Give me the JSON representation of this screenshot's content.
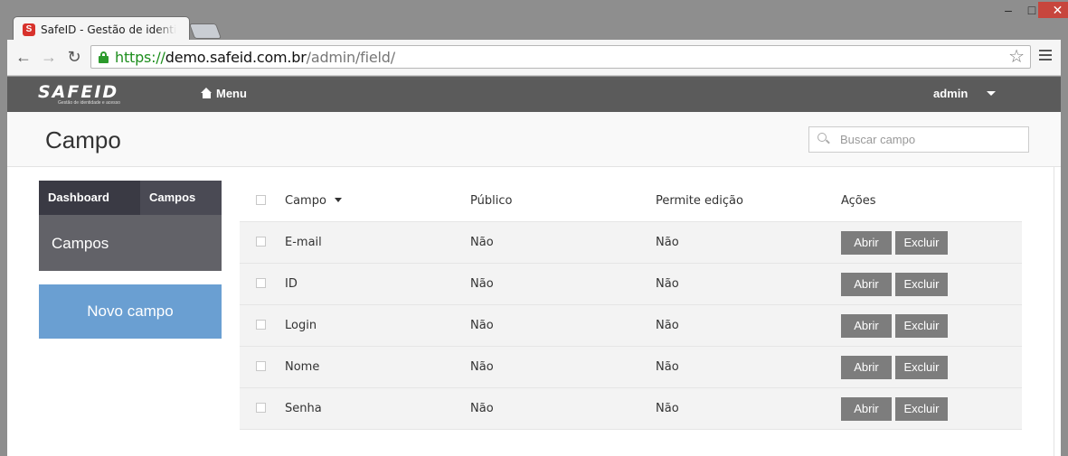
{
  "browser": {
    "tab_title": "SafeID - Gestão de identidade e acesso",
    "favicon": "S",
    "url_scheme": "https://",
    "url_host": "demo.safeid.com.br",
    "url_path": "/admin/field/",
    "window_controls": {
      "minimize": "–",
      "maximize": "□",
      "close": "✕"
    }
  },
  "topnav": {
    "logo_text": "SAFEID",
    "logo_subtitle": "Gestão de identidade e acesso",
    "menu_label": "Menu",
    "user_label": "admin",
    "bg_color": "#5b5b5b"
  },
  "header": {
    "title": "Campo",
    "search_placeholder": "Buscar campo"
  },
  "sidebar": {
    "tabs": [
      {
        "label": "Dashboard"
      },
      {
        "label": "Campos"
      }
    ],
    "active_section": "Campos",
    "new_button_label": "Novo campo",
    "accent_color": "#6a9fd2"
  },
  "table": {
    "columns": [
      "Campo",
      "Público",
      "Permite edição",
      "Ações"
    ],
    "sort_column": "Campo",
    "rows": [
      {
        "campo": "E-mail",
        "publico": "Não",
        "edicao": "Não"
      },
      {
        "campo": "ID",
        "publico": "Não",
        "edicao": "Não"
      },
      {
        "campo": "Login",
        "publico": "Não",
        "edicao": "Não"
      },
      {
        "campo": "Nome",
        "publico": "Não",
        "edicao": "Não"
      },
      {
        "campo": "Senha",
        "publico": "Não",
        "edicao": "Não"
      }
    ],
    "action_open": "Abrir",
    "action_delete": "Excluir"
  }
}
